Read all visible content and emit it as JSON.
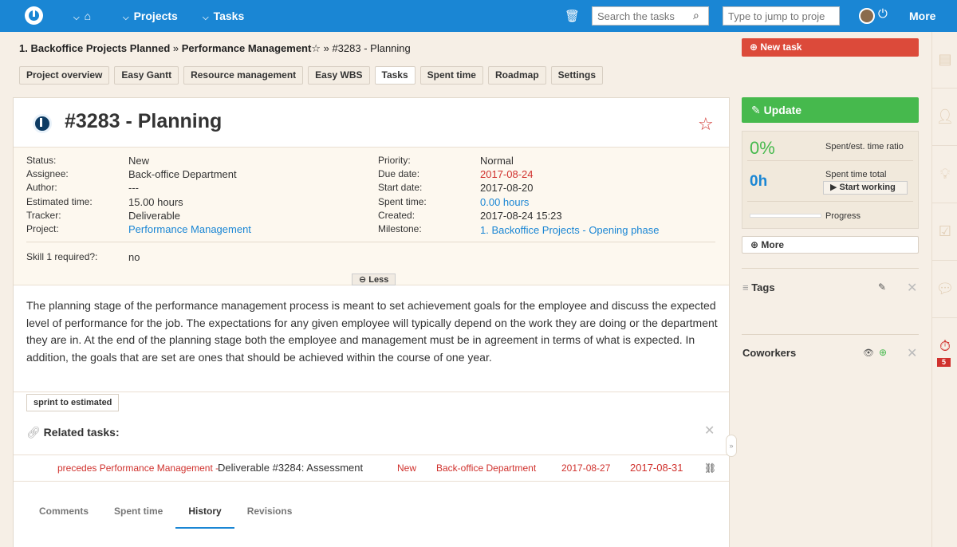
{
  "topbar": {
    "home_icon": "home-icon",
    "projects": "Projects",
    "tasks": "Tasks",
    "search_placeholder": "Search the tasks",
    "jump_placeholder": "Type to jump to proje",
    "more": "More"
  },
  "breadcrumb": {
    "project": "1. Backoffice Projects Planned",
    "sep1": " » ",
    "subproject": "Performance Management",
    "star": "☆",
    "sep2": " » ",
    "current": "#3283 - Planning"
  },
  "subtabs": [
    "Project overview",
    "Easy Gantt",
    "Resource management",
    "Easy WBS",
    "Tasks",
    "Spent time",
    "Roadmap",
    "Settings"
  ],
  "issue": {
    "title": "#3283 - Planning",
    "left_attrs": [
      {
        "label": "Status:",
        "value": "New"
      },
      {
        "label": "Assignee:",
        "value": "Back-office Department"
      },
      {
        "label": "Author:",
        "value": "---"
      },
      {
        "label": "Estimated time:",
        "value": "15.00 hours"
      },
      {
        "label": "Tracker:",
        "value": "Deliverable"
      },
      {
        "label": "Project:",
        "value": "Performance Management"
      }
    ],
    "right_attrs": [
      {
        "label": "Priority:",
        "value": "Normal"
      },
      {
        "label": "Due date:",
        "value": "2017-08-24"
      },
      {
        "label": "Start date:",
        "value": "2017-08-20"
      },
      {
        "label": "Spent time:",
        "value": "0.00 hours"
      },
      {
        "label": "Created:",
        "value": "2017-08-24 15:23"
      },
      {
        "label": "Milestone:",
        "value": "1. Backoffice Projects - Opening phase"
      }
    ],
    "custom_label": "Skill 1 required?:",
    "custom_value": "no",
    "less": "Less",
    "description": "The planning stage of the performance management process is meant to set achievement goals for the employee and discuss the expected level of performance for the job. The expectations for any given employee will typically depend on the work they are doing or the department they are in. At the end of the planning stage both the employee and management must be in agreement in terms of what is expected. In addition, the goals that are set are ones that should be achieved within the course of one year.",
    "tag": "sprint to estimated",
    "related_title": "Related tasks:",
    "related_row": {
      "relation": "precedes Performance Management -",
      "task": "Deliverable #3284: Assessment",
      "status": "New",
      "assignee": "Back-office Department",
      "start": "2017-08-27",
      "due": "2017-08-31"
    },
    "tabs": [
      "Comments",
      "Spent time",
      "History",
      "Revisions"
    ]
  },
  "sidebar": {
    "new_task": "New task",
    "update": "Update",
    "ratio_value": "0%",
    "ratio_label": "Spent/est. time ratio",
    "spent_value": "0h",
    "spent_label": "Spent time total",
    "start_working": "Start working",
    "progress_label": "Progress",
    "progress": 0,
    "more": "More",
    "tags": "Tags",
    "coworkers": "Coworkers"
  },
  "right_rail": {
    "badge": "5"
  }
}
